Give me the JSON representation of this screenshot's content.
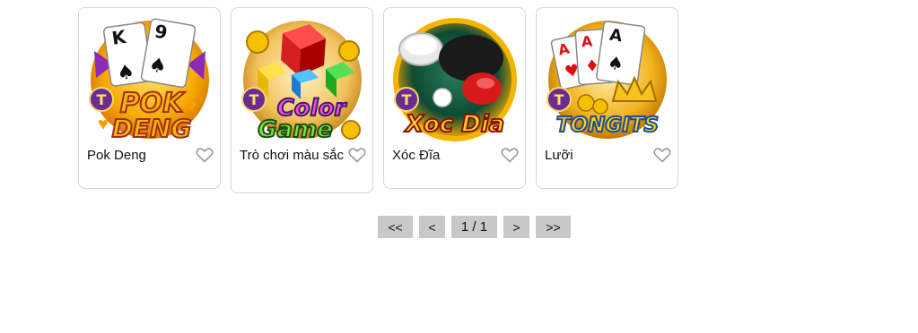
{
  "games": [
    {
      "name": "Pok Deng",
      "logo_line1": "POK",
      "logo_line2": "DENG",
      "badge": "T",
      "card1": "K",
      "card2": "9",
      "favorite_icon": "heart-outline-icon"
    },
    {
      "name": "Trò chơi màu sắc",
      "logo_line1": "Color",
      "logo_line2": "Game",
      "badge": "T",
      "favorite_icon": "heart-outline-icon"
    },
    {
      "name": "Xóc Đĩa",
      "logo_line1": "Xoc Dia",
      "badge": "T",
      "favorite_icon": "heart-outline-icon"
    },
    {
      "name": "Lưỡi",
      "logo_line1": "TONGITS",
      "badge": "T",
      "card1": "A",
      "card2": "A",
      "card3": "A",
      "favorite_icon": "heart-outline-icon"
    }
  ],
  "pagination": {
    "first": "<<",
    "prev": "<",
    "page": "1 / 1",
    "next": ">",
    "last": ">>"
  },
  "colors": {
    "card_border": "#d6d6d6",
    "pager_bg": "#c8c8c8",
    "badge_purple": "#6a2c91",
    "logo_gold": "#f5b800"
  }
}
